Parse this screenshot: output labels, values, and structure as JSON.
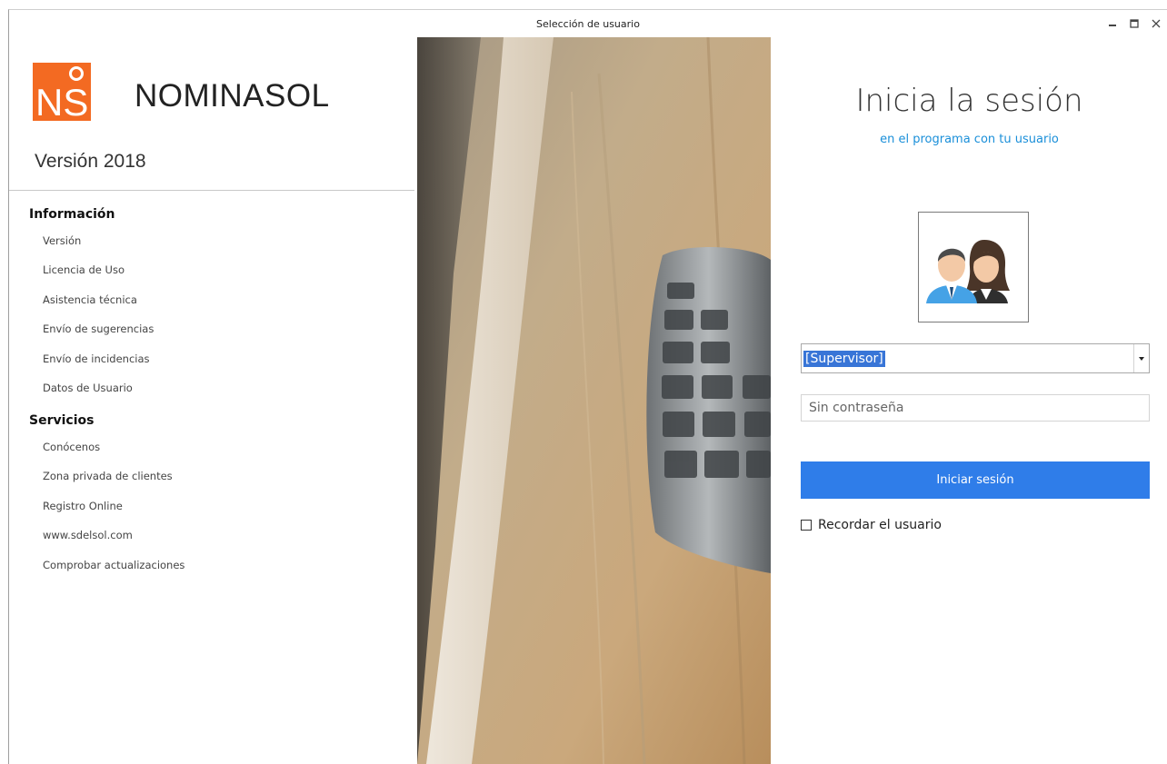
{
  "window": {
    "title": "Selección de usuario"
  },
  "brand": {
    "logo_text": "NS",
    "name": "NOMINASOL",
    "version": "Versión 2018",
    "logo_color": "#f36a22"
  },
  "info_section": {
    "title": "Información",
    "items": [
      {
        "label": "Versión"
      },
      {
        "label": "Licencia de Uso"
      },
      {
        "label": "Asistencia técnica"
      },
      {
        "label": "Envío de sugerencias"
      },
      {
        "label": "Envío de incidencias"
      },
      {
        "label": "Datos de Usuario"
      }
    ]
  },
  "services_section": {
    "title": "Servicios",
    "items": [
      {
        "label": "Conócenos"
      },
      {
        "label": "Zona privada de clientes"
      },
      {
        "label": "Registro Online"
      },
      {
        "label": "www.sdelsol.com"
      },
      {
        "label": "Comprobar actualizaciones"
      }
    ]
  },
  "login": {
    "title": "Inicia la sesión",
    "subtitle": "en el programa con tu usuario",
    "selected_user": "[Supervisor]",
    "password_placeholder": "Sin contraseña",
    "button_label": "Iniciar sesión",
    "remember_label": "Recordar el usuario",
    "accent_color": "#2f7de9",
    "subtitle_color": "#1a8fd9"
  }
}
